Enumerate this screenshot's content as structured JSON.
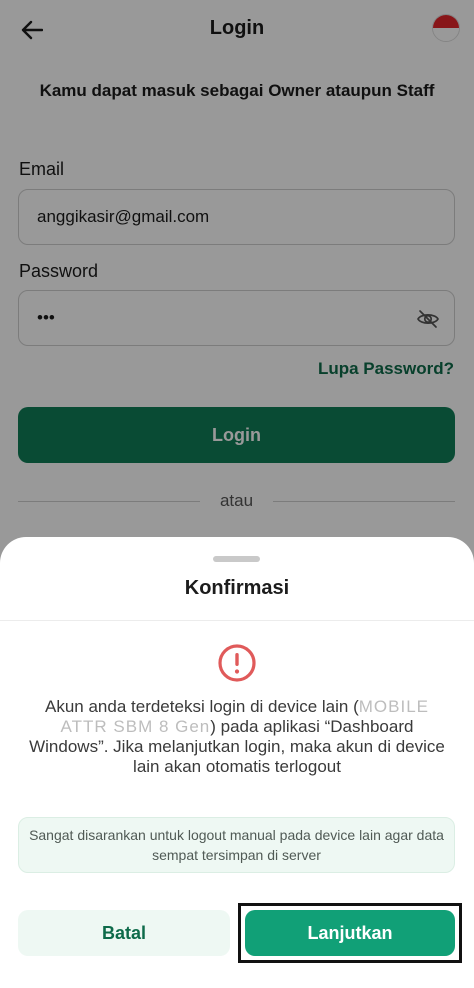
{
  "app_bar": {
    "title": "Login"
  },
  "login_form": {
    "subtitle": "Kamu dapat masuk sebagai Owner ataupun Staff",
    "email_label": "Email",
    "email_value": "anggikasir@gmail.com",
    "password_label": "Password",
    "password_value": "•••",
    "forgot_password": "Lupa Password?",
    "login_button": "Login",
    "divider_text": "atau"
  },
  "dialog": {
    "title": "Konfirmasi",
    "message_part1": "Akun anda terdeteksi login di device lain (",
    "device_name": "MOBILE ATTR SBM 8 Gen",
    "message_part2": ") pada aplikasi “Dashboard Windows”. Jika melanjutkan login, maka akun di device lain akan otomatis terlogout",
    "info": "Sangat disarankan untuk logout manual pada device lain agar data sempat tersimpan di server",
    "cancel_button": "Batal",
    "continue_button": "Lanjutkan"
  },
  "colors": {
    "primary": "#0f7d58",
    "accent": "#11a077",
    "alert": "#e05a5a",
    "info_bg": "#eef8f3"
  }
}
